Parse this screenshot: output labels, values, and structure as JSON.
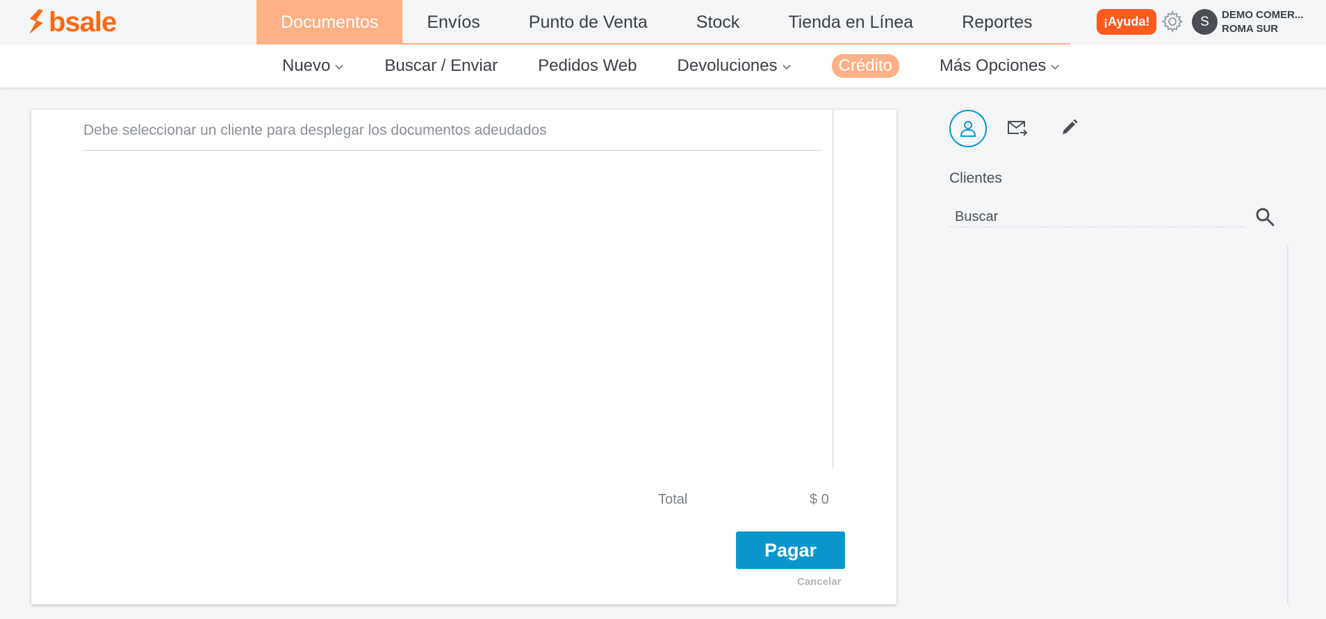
{
  "brand": {
    "name": "bsale",
    "color": "#ff6a13"
  },
  "main_nav": [
    {
      "label": "Documentos",
      "active": true
    },
    {
      "label": "Envíos"
    },
    {
      "label": "Punto de Venta"
    },
    {
      "label": "Stock"
    },
    {
      "label": "Tienda en Línea"
    },
    {
      "label": "Reportes"
    }
  ],
  "help_label": "¡Ayuda!",
  "account": {
    "avatar_letter": "S",
    "line1": "DEMO COMER...",
    "line2": "ROMA SUR"
  },
  "sub_nav": [
    {
      "label": "Nuevo",
      "dropdown": true
    },
    {
      "label": "Buscar / Enviar"
    },
    {
      "label": "Pedidos Web"
    },
    {
      "label": "Devoluciones",
      "dropdown": true
    },
    {
      "label": "Crédito",
      "active": true
    },
    {
      "label": "Más Opciones",
      "dropdown": true
    }
  ],
  "main": {
    "empty_message": "Debe seleccionar un cliente para desplegar los documentos adeudados",
    "total_label": "Total",
    "total_value": "$ 0",
    "pay_button": "Pagar",
    "cancel_link": "Cancelar"
  },
  "right_panel": {
    "tabs": [
      "user-icon",
      "mail-forward-icon",
      "pencil-icon"
    ],
    "clients_title": "Clientes",
    "search_placeholder": "Buscar"
  },
  "colors": {
    "accent_orange": "#ffb085",
    "help_orange": "#ff5a1f",
    "primary_blue": "#0a97cc"
  }
}
